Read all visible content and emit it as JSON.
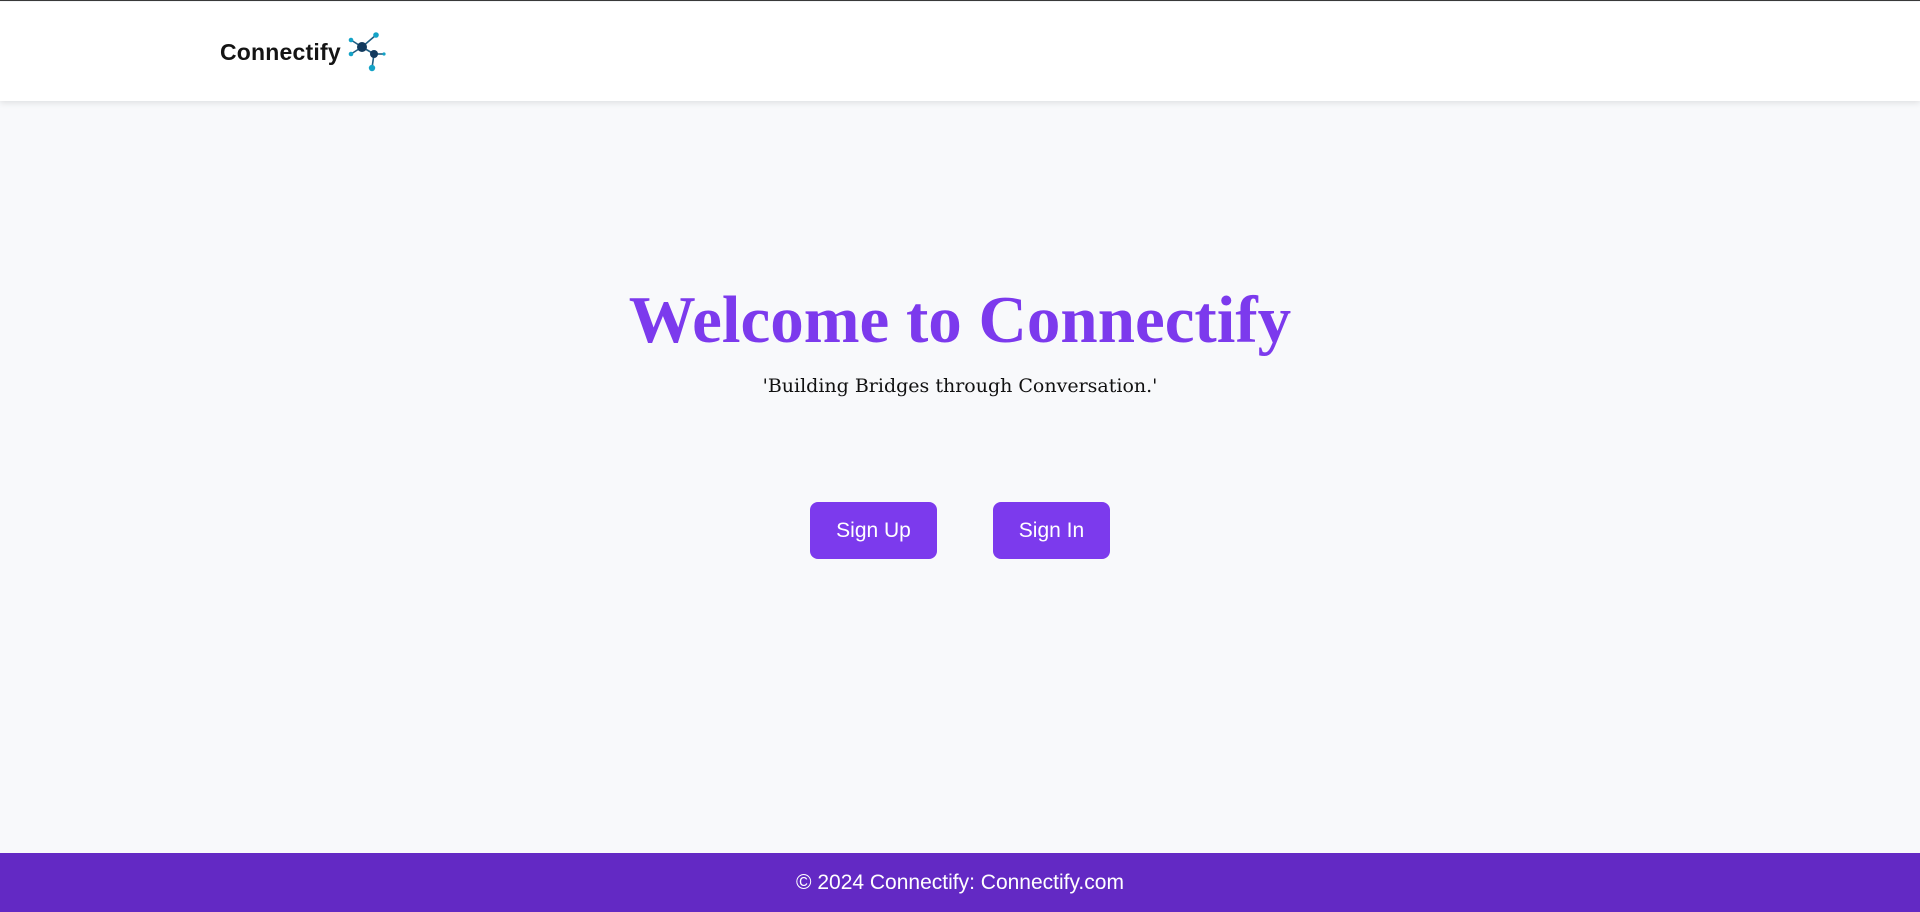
{
  "header": {
    "brand_name": "Connectify",
    "brand_icon": "network-nodes-icon"
  },
  "hero": {
    "title": "Welcome to Connectify",
    "tagline": "'Building Bridges through Conversation.'"
  },
  "actions": {
    "signup_label": "Sign Up",
    "signin_label": "Sign In"
  },
  "footer": {
    "text": "© 2024 Connectify: Connectify.com"
  },
  "colors": {
    "accent": "#7c3aed",
    "footer_bg": "#6329c4",
    "page_bg": "#f8f9fb",
    "icon_dark": "#123a5e",
    "icon_teal": "#14a3c7"
  }
}
